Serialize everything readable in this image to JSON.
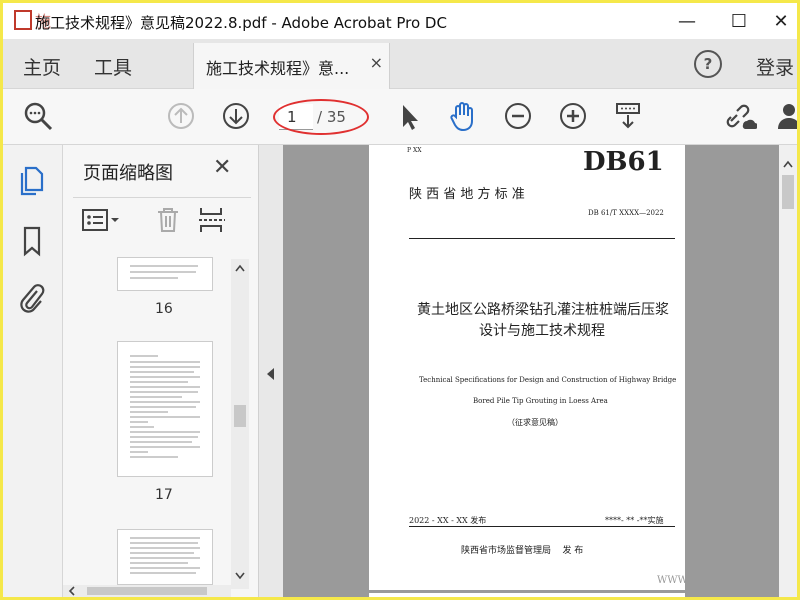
{
  "window": {
    "title": "施工技术规程》意见稿2022.8.pdf - Adobe Acrobat Pro DC",
    "minimize": "—",
    "maximize": "☐",
    "close": "✕"
  },
  "tabs": {
    "home": "主页",
    "tools": "工具",
    "doc_tab": "施工技术规程》意...",
    "doc_close": "×",
    "help": "?",
    "login": "登录"
  },
  "toolbar": {
    "current_page": "1",
    "total_pages": "/ 35",
    "annotation_color": "#e03030"
  },
  "panel": {
    "title": "页面缩略图",
    "close": "✕",
    "thumbs": [
      {
        "label": "16"
      },
      {
        "label": "17"
      }
    ]
  },
  "page": {
    "header_small": "P XX",
    "code": "DB61",
    "issuer": "陕 西 省 地 方 标 准",
    "std_no": "DB 61/T XXXX—2022",
    "title_cn_1": "黄土地区公路桥梁钻孔灌注桩桩端后压浆",
    "title_cn_2": "设计与施工技术规程",
    "title_en_1": "Technical Specifications for Design and Construction of Highway Bridge",
    "title_en_2": "Bored Pile Tip Grouting in Loess Area",
    "draft_note": "（征求意见稿）",
    "publish_date": "2022 - XX - XX 发布",
    "effective_date": "****- ** -**实施",
    "publisher": "陕西省市场监督管理局    发 布",
    "watermark": "WWW"
  }
}
